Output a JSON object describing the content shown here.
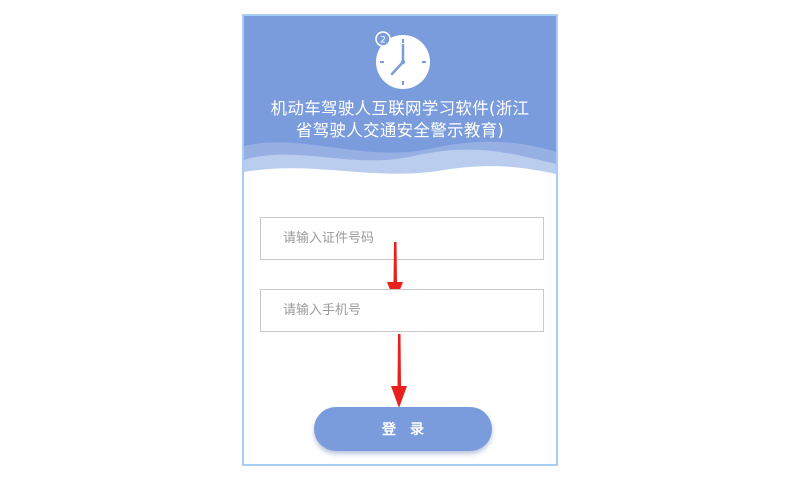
{
  "header": {
    "title_line1": "机动车驾驶人互联网学习软件(浙江",
    "title_line2": "省驾驶人交通安全警示教育)",
    "clock_badge": "2"
  },
  "form": {
    "id_placeholder": "请输入证件号码",
    "id_value": "",
    "phone_placeholder": "请输入手机号",
    "phone_value": ""
  },
  "login_label": "登录",
  "colors": {
    "header_bg": "#7b9cdc",
    "button_bg": "#7b9cdc",
    "frame_border": "#a9cdf2",
    "arrow": "#e8211d"
  },
  "icons": {
    "clock": "clock-icon",
    "arrows": "down-arrow-icon"
  }
}
